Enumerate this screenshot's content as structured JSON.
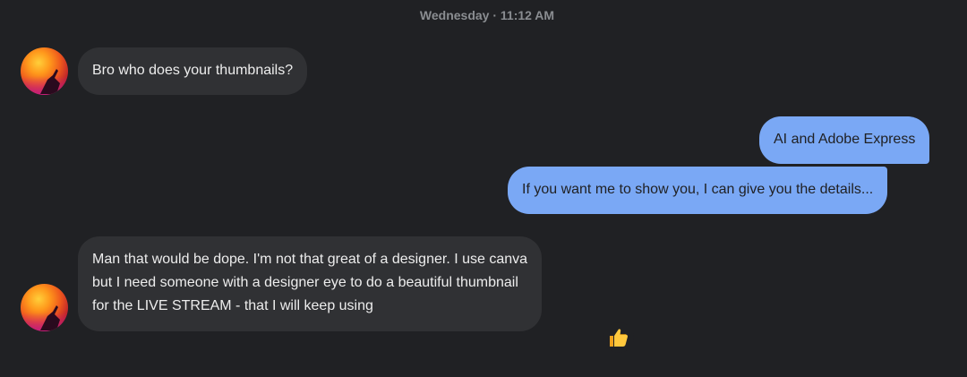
{
  "timestamp": "Wednesday · 11:12 AM",
  "messages": [
    {
      "sender": "them",
      "lines": [
        "Bro who does your thumbnails?"
      ]
    },
    {
      "sender": "me",
      "lines": [
        "AI and Adobe Express"
      ]
    },
    {
      "sender": "me",
      "lines": [
        "If you want me to show you, I can give you the details..."
      ]
    },
    {
      "sender": "them",
      "lines": [
        "Man that would be dope. I'm not that great of a designer. I use canva",
        "but I need someone with a designer eye to do a beautiful thumbnail",
        "for the LIVE STREAM - that I will keep using"
      ],
      "reaction": "thumbs-up-icon"
    }
  ],
  "colors": {
    "background": "#202124",
    "incoming_bubble": "#303134",
    "outgoing_bubble": "#7aa8f5",
    "timestamp_text": "#8a8d91"
  }
}
